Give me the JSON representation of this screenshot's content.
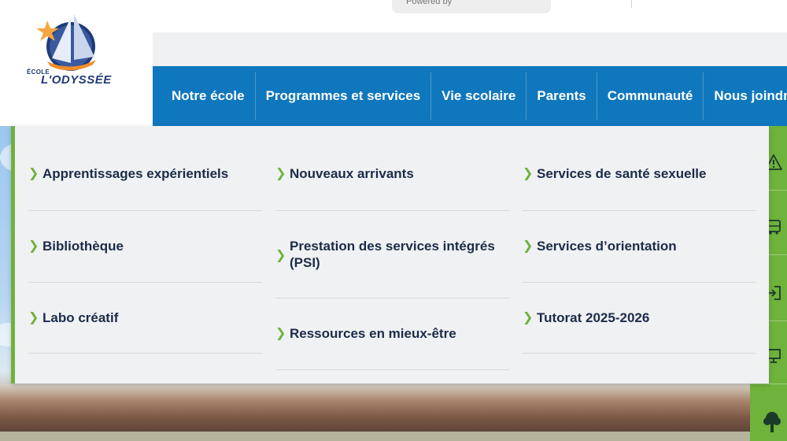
{
  "topbar": {
    "powered_by": "Powered by"
  },
  "logo": {
    "ecole": "ÉCOLE",
    "name": "L'ODYSSÉE"
  },
  "nav": {
    "items": [
      {
        "label": "Notre école"
      },
      {
        "label": "Programmes et services"
      },
      {
        "label": "Vie scolaire"
      },
      {
        "label": "Parents"
      },
      {
        "label": "Communauté"
      },
      {
        "label": "Nous joindre"
      }
    ]
  },
  "mega_menu": {
    "columns": [
      {
        "items": [
          {
            "label": "Apprentissages expérientiels"
          },
          {
            "label": "Bibliothèque"
          },
          {
            "label": "Labo créatif"
          }
        ]
      },
      {
        "items": [
          {
            "label": "Nouveaux arrivants"
          },
          {
            "label": "Prestation des services intégrés (PSI)"
          },
          {
            "label": "Ressources en mieux-être"
          }
        ]
      },
      {
        "items": [
          {
            "label": "Services de santé sexuelle"
          },
          {
            "label": "Services d’orientation"
          },
          {
            "label": "Tutorat 2025-2026"
          }
        ]
      }
    ]
  },
  "toolbar": {
    "icons": [
      "alert-icon",
      "bus-icon",
      "login-icon",
      "monitor-icon",
      "tree-icon"
    ]
  },
  "colors": {
    "nav_blue": "#0f77bd",
    "accent_green": "#6fb23c",
    "menu_bg": "#f0f1f3",
    "text_dark": "#1c2b4a"
  }
}
